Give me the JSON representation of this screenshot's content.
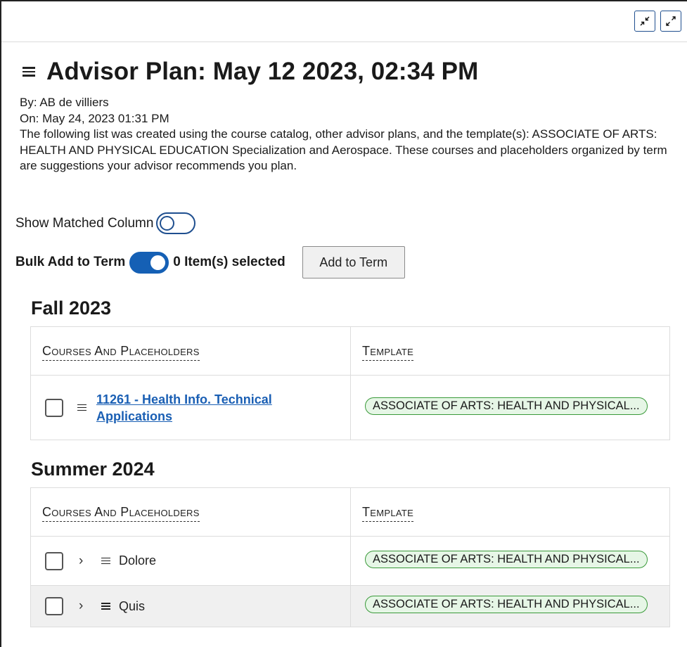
{
  "window": {
    "collapse_icon": "collapse-arrows-icon",
    "expand_icon": "expand-arrows-icon"
  },
  "plan": {
    "title": "Advisor Plan: May 12 2023, 02:34 PM",
    "by": "By: AB de villiers",
    "on": "On: May 24, 2023 01:31 PM",
    "description": "The following list was created using the course catalog, other advisor plans, and the template(s): ASSOCIATE OF ARTS: HEALTH AND PHYSICAL EDUCATION Specialization and Aerospace. These courses and placeholders organized by term are suggestions your advisor recommends you plan."
  },
  "controls": {
    "show_matched_label": "Show Matched Column",
    "show_matched_on": false,
    "bulk_add_label": "Bulk Add to Term",
    "bulk_add_on": true,
    "selected_count": "0 Item(s) selected",
    "add_to_term_button": "Add to Term"
  },
  "terms": [
    {
      "name": "Fall 2023",
      "col_courses": "Courses And Placeholders",
      "col_template": "Template",
      "rows": [
        {
          "kind": "course",
          "label": "11261 - Health Info. Technical Applications",
          "template": "ASSOCIATE OF ARTS: HEALTH AND PHYSICAL..."
        }
      ]
    },
    {
      "name": "Summer 2024",
      "col_courses": "Courses And Placeholders",
      "col_template": "Template",
      "rows": [
        {
          "kind": "placeholder",
          "label": "Dolore",
          "template": "ASSOCIATE OF ARTS: HEALTH AND PHYSICAL..."
        },
        {
          "kind": "placeholder",
          "label": "Quis",
          "template": "ASSOCIATE OF ARTS: HEALTH AND PHYSICAL..."
        }
      ]
    }
  ]
}
